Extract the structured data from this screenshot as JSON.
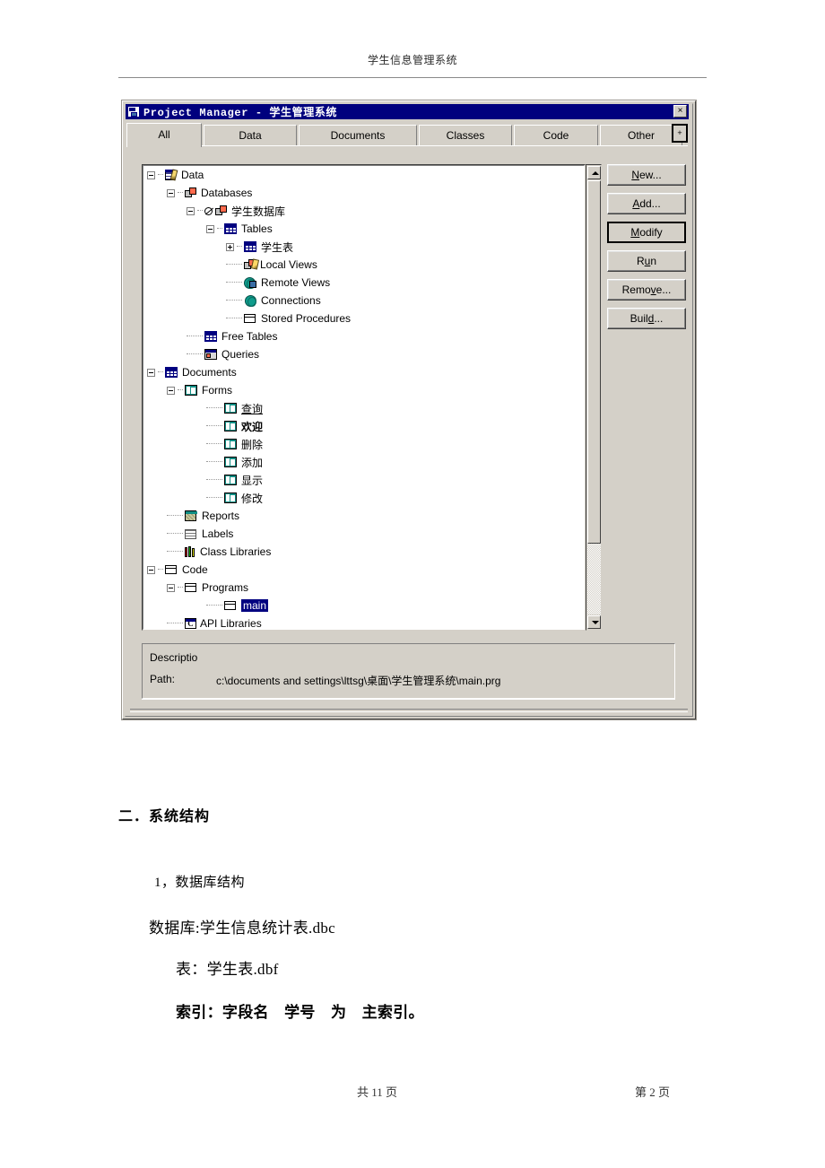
{
  "page": {
    "header_title": "学生信息管理系统",
    "footer_left": "共 11 页",
    "footer_right": "第 2 页"
  },
  "window": {
    "title": "Project Manager - 学生管理系统",
    "close_label": "×",
    "icon": "project-manager-icon"
  },
  "tabs": {
    "items": [
      {
        "label": "All",
        "active": true
      },
      {
        "label": "Data",
        "active": false
      },
      {
        "label": "Documents",
        "active": false
      },
      {
        "label": "Classes",
        "active": false
      },
      {
        "label": "Code",
        "active": false
      },
      {
        "label": "Other",
        "active": false
      }
    ],
    "scroll_button": "+"
  },
  "tree": {
    "items": [
      {
        "label": "Data",
        "indent": 0,
        "expander": "minus",
        "icon": "data-project-icon",
        "style": "normal"
      },
      {
        "label": "Databases",
        "indent": 1,
        "expander": "minus",
        "icon": "databases-icon",
        "style": "normal"
      },
      {
        "label": "学生数据库",
        "indent": 2,
        "expander": "minus",
        "icon": "database-excluded-icon",
        "style": "normal",
        "prefix": "excluded-mark"
      },
      {
        "label": "Tables",
        "indent": 3,
        "expander": "minus",
        "icon": "table-grid-icon",
        "style": "normal"
      },
      {
        "label": "学生表",
        "indent": 4,
        "expander": "plus",
        "icon": "table-grid-icon",
        "style": "normal"
      },
      {
        "label": "Local Views",
        "indent": 4,
        "expander": "none",
        "icon": "local-views-icon",
        "style": "normal"
      },
      {
        "label": "Remote Views",
        "indent": 4,
        "expander": "none",
        "icon": "remote-views-icon",
        "style": "normal"
      },
      {
        "label": "Connections",
        "indent": 4,
        "expander": "none",
        "icon": "connections-globe-icon",
        "style": "normal"
      },
      {
        "label": "Stored Procedures",
        "indent": 4,
        "expander": "none",
        "icon": "stored-procedures-icon",
        "style": "normal"
      },
      {
        "label": "Free Tables",
        "indent": 2,
        "expander": "none",
        "icon": "table-grid-icon",
        "style": "normal"
      },
      {
        "label": "Queries",
        "indent": 2,
        "expander": "none",
        "icon": "queries-icon",
        "style": "normal"
      },
      {
        "label": "Documents",
        "indent": 0,
        "expander": "minus",
        "icon": "documents-icon",
        "style": "normal"
      },
      {
        "label": "Forms",
        "indent": 1,
        "expander": "minus",
        "icon": "form-icon",
        "style": "normal"
      },
      {
        "label": "查询",
        "indent": 3,
        "expander": "none",
        "icon": "form-icon",
        "style": "underline"
      },
      {
        "label": "欢迎",
        "indent": 3,
        "expander": "none",
        "icon": "form-icon",
        "style": "bold"
      },
      {
        "label": "删除",
        "indent": 3,
        "expander": "none",
        "icon": "form-icon",
        "style": "normal"
      },
      {
        "label": "添加",
        "indent": 3,
        "expander": "none",
        "icon": "form-icon",
        "style": "normal"
      },
      {
        "label": "显示",
        "indent": 3,
        "expander": "none",
        "icon": "form-icon",
        "style": "normal"
      },
      {
        "label": "修改",
        "indent": 3,
        "expander": "none",
        "icon": "form-icon",
        "style": "normal"
      },
      {
        "label": "Reports",
        "indent": 1,
        "expander": "none",
        "icon": "reports-icon",
        "style": "normal"
      },
      {
        "label": "Labels",
        "indent": 1,
        "expander": "none",
        "icon": "labels-icon",
        "style": "normal"
      },
      {
        "label": "Class Libraries",
        "indent": 1,
        "expander": "none",
        "icon": "class-libraries-icon",
        "style": "normal"
      },
      {
        "label": "Code",
        "indent": 0,
        "expander": "minus",
        "icon": "code-icon",
        "style": "normal"
      },
      {
        "label": "Programs",
        "indent": 1,
        "expander": "minus",
        "icon": "programs-icon",
        "style": "normal"
      },
      {
        "label": "main",
        "indent": 3,
        "expander": "none",
        "icon": "program-file-icon",
        "style": "selected"
      },
      {
        "label": "API Libraries",
        "indent": 1,
        "expander": "none",
        "icon": "api-libraries-icon",
        "style": "normal"
      }
    ]
  },
  "buttons": [
    {
      "label": "New...",
      "accel": "N",
      "default": false
    },
    {
      "label": "Add...",
      "accel": "A",
      "default": false
    },
    {
      "label": "Modify",
      "accel": "M",
      "default": true
    },
    {
      "label": "Run",
      "accel": "u",
      "default": false
    },
    {
      "label": "Remove...",
      "accel": "v",
      "default": false
    },
    {
      "label": "Build...",
      "accel": "d",
      "default": false
    }
  ],
  "description": {
    "label": "Descriptio",
    "path_label": "Path:",
    "path_value": "c:\\documents and settings\\lttsg\\桌面\\学生管理系统\\main.prg"
  },
  "document": {
    "heading": "二．系统结构",
    "line1": "1，数据库结构",
    "line2": "数据库:学生信息统计表.dbc",
    "line3": "表：学生表.dbf",
    "line4": "索引：字段名　学号　为　主索引。"
  },
  "colors": {
    "titlebar": "#00007e",
    "face": "#d4d0c8",
    "selection": "#000080",
    "form_icon": "#0f8e84"
  }
}
